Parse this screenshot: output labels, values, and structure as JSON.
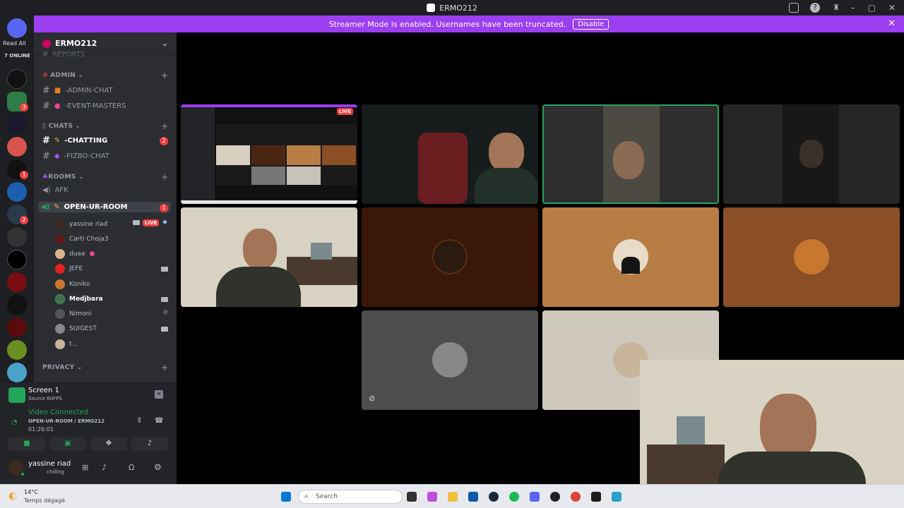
{
  "window": {
    "title": "ERMO212"
  },
  "banner": {
    "text": "Streamer Mode is enabled. Usernames have been truncated.",
    "button": "Disable"
  },
  "rail": {
    "read_all": "Read All",
    "online": "7 ONLINE",
    "badges": [
      "3",
      "1",
      "2"
    ]
  },
  "server": {
    "name": "ERMO212",
    "truncated_top": "REPORTS"
  },
  "categories": [
    {
      "label": "ADMIN",
      "channels": [
        "-ADMIN-CHAT",
        "-EVENT-MASTERS"
      ]
    },
    {
      "label": "CHATS",
      "channels": [
        "-CHATTING",
        "-FIZBO-CHAT"
      ],
      "badge": "2"
    },
    {
      "label": "ROOMS",
      "channels": [
        "AFK",
        "OPEN-UR-ROOM"
      ],
      "badge": "1"
    },
    {
      "label": "PRIVACY",
      "channels": []
    }
  ],
  "voice_users": [
    "yassine riad",
    "Carti Choja3",
    "duaa",
    "JEFE",
    "Koniko",
    "Medjbara",
    "Nimoni",
    "SUIGEST",
    "t..."
  ],
  "live_label": "LIVE",
  "stream": {
    "title": "Screen 1",
    "source": "Source 60FPS",
    "status": "Video Connected",
    "channel": "OPEN-UR-ROOM / ERMO212",
    "timer": "01:26:01"
  },
  "user": {
    "name": "yassine riad",
    "status": "chilling"
  },
  "weather": {
    "temp": "14°C",
    "desc": "Temps dégagé"
  },
  "taskbar": {
    "search": "Search"
  },
  "colors": {
    "accent": "#9b3ff0",
    "live": "#f23f43",
    "online": "#23a55a"
  }
}
